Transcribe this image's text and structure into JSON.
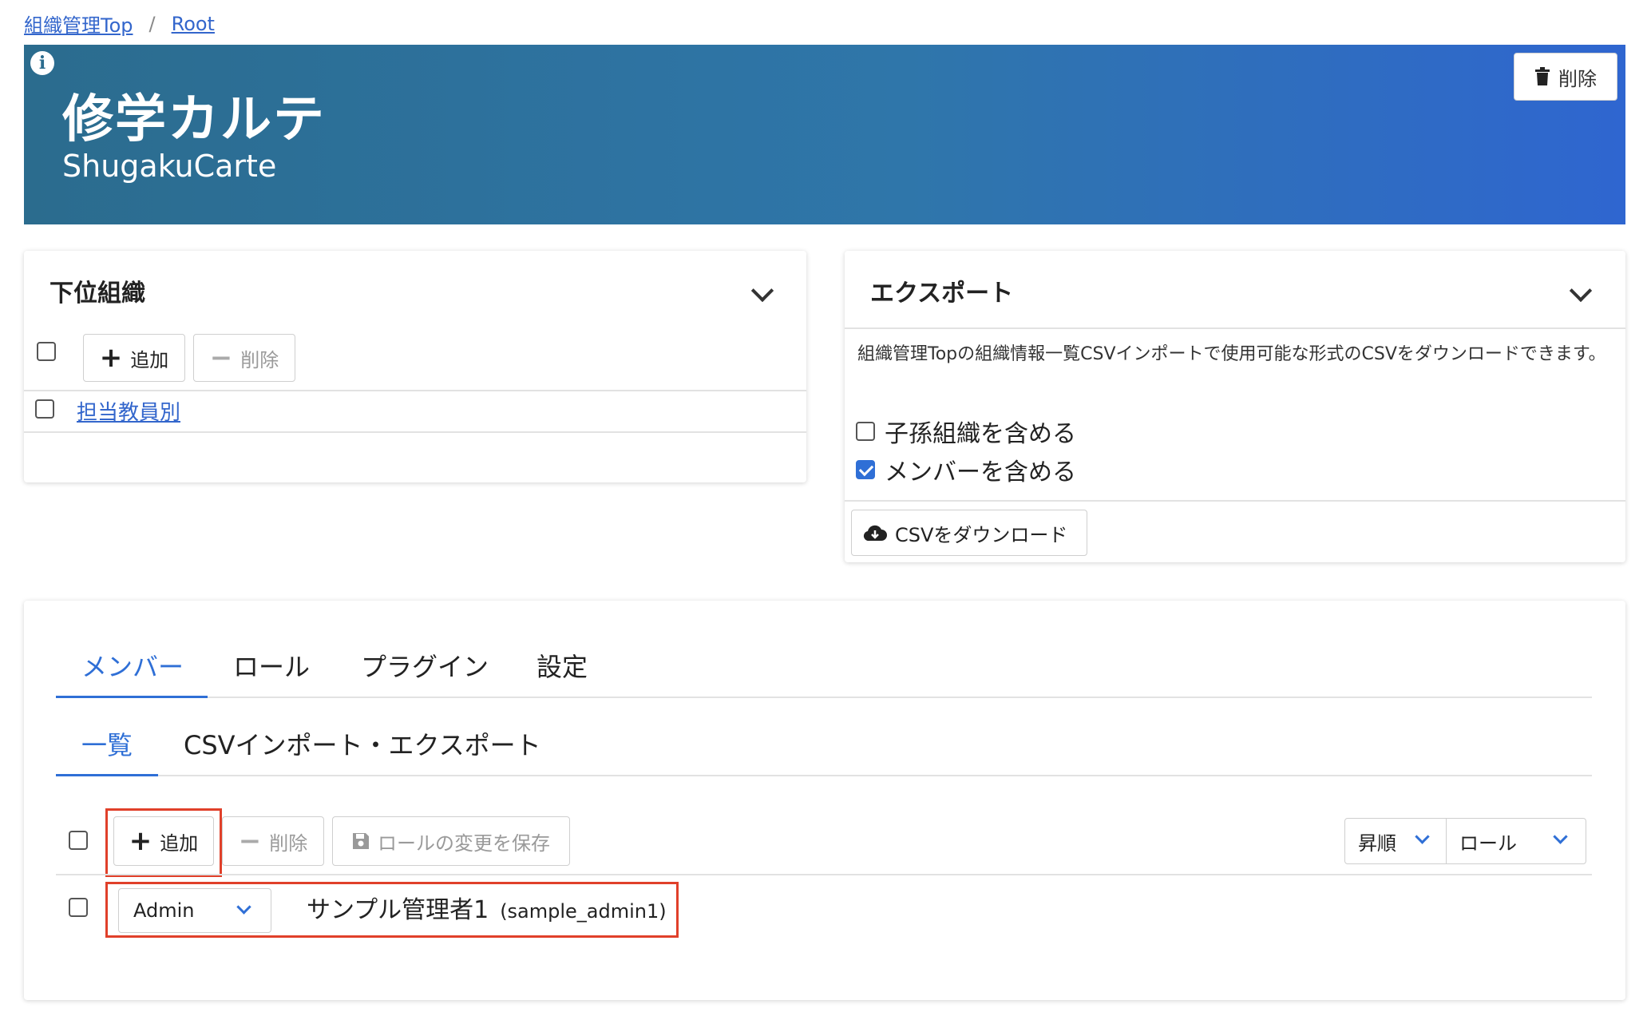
{
  "breadcrumb": {
    "item1": "組織管理Top",
    "sep": "/",
    "item2": "Root"
  },
  "hero": {
    "title": "修学カルテ",
    "subtitle": "ShugakuCarte",
    "delete_label": "削除",
    "info_icon": "i"
  },
  "sub_org": {
    "title": "下位組織",
    "add_label": "追加",
    "delete_label": "削除",
    "items": [
      {
        "label": "担当教員別"
      }
    ]
  },
  "export": {
    "title": "エクスポート",
    "description": "組織管理Topの組織情報一覧CSVインポートで使用可能な形式のCSVをダウンロードできます。",
    "options": [
      {
        "label": "子孫組織を含める",
        "checked": false
      },
      {
        "label": "メンバーを含める",
        "checked": true
      }
    ],
    "download_label": "CSVをダウンロード"
  },
  "main_tabs": [
    {
      "label": "メンバー",
      "active": true
    },
    {
      "label": "ロール",
      "active": false
    },
    {
      "label": "プラグイン",
      "active": false
    },
    {
      "label": "設定",
      "active": false
    }
  ],
  "sub_tabs": [
    {
      "label": "一覧",
      "active": true
    },
    {
      "label": "CSVインポート・エクスポート",
      "active": false
    }
  ],
  "member_toolbar": {
    "add_label": "追加",
    "delete_label": "削除",
    "save_roles_label": "ロールの変更を保存",
    "sort_order": "昇順",
    "sort_key": "ロール"
  },
  "members": [
    {
      "role": "Admin",
      "name": "サンプル管理者1",
      "username": "(sample_admin1)"
    }
  ],
  "colors": {
    "accent": "#2f6fd6",
    "highlight": "#e0402a",
    "banner_start": "#2b6c8e",
    "banner_end": "#2f66d0"
  }
}
